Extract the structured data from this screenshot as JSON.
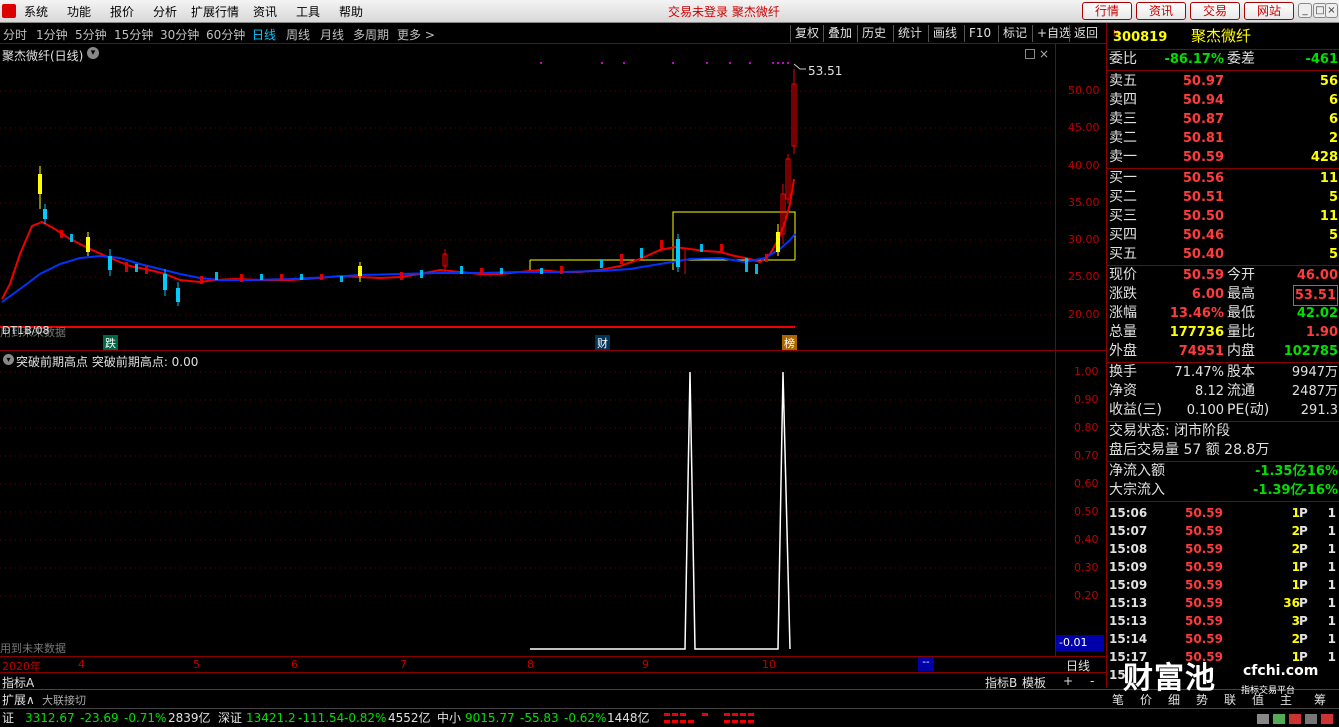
{
  "menubar": {
    "items": [
      "系统",
      "功能",
      "报价",
      "分析",
      "扩展行情",
      "资讯",
      "工具",
      "帮助"
    ],
    "center_text": "交易未登录 聚杰微纤",
    "right_buttons": [
      "行情",
      "资讯",
      "交易",
      "网站"
    ]
  },
  "periodbar": {
    "periods": [
      "分时",
      "1分钟",
      "5分钟",
      "15分钟",
      "30分钟",
      "60分钟",
      "日线",
      "周线",
      "月线",
      "多周期",
      "更多 >"
    ],
    "active": "日线",
    "tools": [
      "复权",
      "叠加",
      "历史",
      "统计",
      "画线",
      "F10",
      "标记",
      "+自选",
      "返回"
    ]
  },
  "main_chart": {
    "title": "聚杰微纤(日线)",
    "max_label": "53.51",
    "y_ticks": [
      "50.00",
      "45.00",
      "40.00",
      "35.00",
      "30.00",
      "25.00",
      "20.00"
    ],
    "bottom_left": "用到未来数据",
    "bottom_left_date": "DT1B/08",
    "markers": [
      "跌",
      "财",
      "榜"
    ]
  },
  "indicator": {
    "title": "突破前期高点 突破前期高点: 0.00",
    "y_ticks": [
      "1.00",
      "0.90",
      "0.80",
      "0.70",
      "0.60",
      "0.50",
      "0.40",
      "0.30",
      "0.20"
    ],
    "current_value": "-0.01",
    "bottom_left": "用到未来数据"
  },
  "chart_data": {
    "type": "line",
    "series": [
      {
        "name": "突破前期高点",
        "x_months": [
          "8",
          "9",
          "10"
        ],
        "values": [
          0,
          0,
          0,
          1,
          0,
          0,
          0,
          1,
          0
        ]
      }
    ],
    "ylim": [
      0,
      1
    ]
  },
  "time_axis": {
    "labels": [
      "2020年",
      "4",
      "5",
      "6",
      "7",
      "8",
      "9",
      "10"
    ],
    "period_button": "日线",
    "dash": "--"
  },
  "tabs_row1": {
    "left": "指标A",
    "right": [
      "指标B",
      "模板",
      "+",
      "-"
    ]
  },
  "tabs_row2": {
    "left": [
      "扩展∧",
      "大联接切"
    ],
    "right": [
      "笔",
      "价",
      "细",
      "势",
      "联",
      "值",
      "主",
      "筹"
    ]
  },
  "quote": {
    "code": "300819",
    "name": "聚杰微纤",
    "wei_bi_label": "委比",
    "wei_bi": "-86.17%",
    "wei_cha_label": "委差",
    "wei_cha": "-461",
    "asks": [
      {
        "label": "卖五",
        "price": "50.97",
        "vol": "56"
      },
      {
        "label": "卖四",
        "price": "50.94",
        "vol": "6"
      },
      {
        "label": "卖三",
        "price": "50.87",
        "vol": "6"
      },
      {
        "label": "卖二",
        "price": "50.81",
        "vol": "2"
      },
      {
        "label": "卖一",
        "price": "50.59",
        "vol": "428"
      }
    ],
    "bids": [
      {
        "label": "买一",
        "price": "50.56",
        "vol": "11"
      },
      {
        "label": "买二",
        "price": "50.51",
        "vol": "5"
      },
      {
        "label": "买三",
        "price": "50.50",
        "vol": "11"
      },
      {
        "label": "买四",
        "price": "50.46",
        "vol": "5"
      },
      {
        "label": "买五",
        "price": "50.40",
        "vol": "5"
      }
    ],
    "stats": [
      {
        "l": "现价",
        "v": "50.59",
        "vc": "red",
        "l2": "今开",
        "v2": "46.00",
        "v2c": "red"
      },
      {
        "l": "涨跌",
        "v": "6.00",
        "vc": "red",
        "l2": "最高",
        "v2": "53.51",
        "v2c": "red"
      },
      {
        "l": "涨幅",
        "v": "13.46%",
        "vc": "red",
        "l2": "最低",
        "v2": "42.02",
        "v2c": "green"
      },
      {
        "l": "总量",
        "v": "177736",
        "vc": "yellow",
        "l2": "量比",
        "v2": "1.90",
        "v2c": "red"
      },
      {
        "l": "外盘",
        "v": "74951",
        "vc": "red",
        "l2": "内盘",
        "v2": "102785",
        "v2c": "green"
      }
    ],
    "stats2": [
      {
        "l": "换手",
        "v": "71.47%",
        "vc": "white",
        "l2": "股本",
        "v2": "9947万",
        "v2c": "white"
      },
      {
        "l": "净资",
        "v": "8.12",
        "vc": "white",
        "l2": "流通",
        "v2": "2487万",
        "v2c": "white"
      },
      {
        "l": "收益(三)",
        "v": "0.100",
        "vc": "white",
        "l2": "PE(动)",
        "v2": "291.3",
        "v2c": "white"
      }
    ],
    "status_text": "交易状态: 闭市阶段",
    "after_text": "盘后交易量 57 额 28.8万",
    "net_inflow_label": "净流入额",
    "net_inflow": "-1.35亿",
    "net_inflow_pct": "-16%",
    "block_inflow_label": "大宗流入",
    "block_inflow": "-1.39亿",
    "block_inflow_pct": "-16%",
    "ticks": [
      {
        "t": "15:06",
        "p": "50.59",
        "q": "1",
        "f": "P",
        "n": "1"
      },
      {
        "t": "15:07",
        "p": "50.59",
        "q": "2",
        "f": "P",
        "n": "1"
      },
      {
        "t": "15:08",
        "p": "50.59",
        "q": "2",
        "f": "P",
        "n": "1"
      },
      {
        "t": "15:09",
        "p": "50.59",
        "q": "1",
        "f": "P",
        "n": "1"
      },
      {
        "t": "15:09",
        "p": "50.59",
        "q": "1",
        "f": "P",
        "n": "1"
      },
      {
        "t": "15:13",
        "p": "50.59",
        "q": "36",
        "f": "P",
        "n": "1"
      },
      {
        "t": "15:13",
        "p": "50.59",
        "q": "3",
        "f": "P",
        "n": "1"
      },
      {
        "t": "15:14",
        "p": "50.59",
        "q": "2",
        "f": "P",
        "n": "1"
      },
      {
        "t": "15:17",
        "p": "50.59",
        "q": "1",
        "f": "P",
        "n": "1"
      },
      {
        "t": "15",
        "p": "",
        "q": "",
        "f": "",
        "n": ""
      }
    ]
  },
  "watermark": {
    "big": "财富池",
    "small": "cfchi.com",
    "sub": "指标交易平台"
  },
  "statusbar": {
    "items": [
      {
        "name": "证",
        "val": "3312.67",
        "chg": "-23.69",
        "pct": "-0.71%",
        "amt": "2839亿"
      },
      {
        "name": "深证",
        "val": "13421.2",
        "chg": "-111.54",
        "pct": "-0.82%",
        "amt": "4552亿"
      },
      {
        "name": "中小",
        "val": "9015.77",
        "chg": "-55.83",
        "pct": "-0.62%",
        "amt": "1448亿"
      }
    ]
  }
}
